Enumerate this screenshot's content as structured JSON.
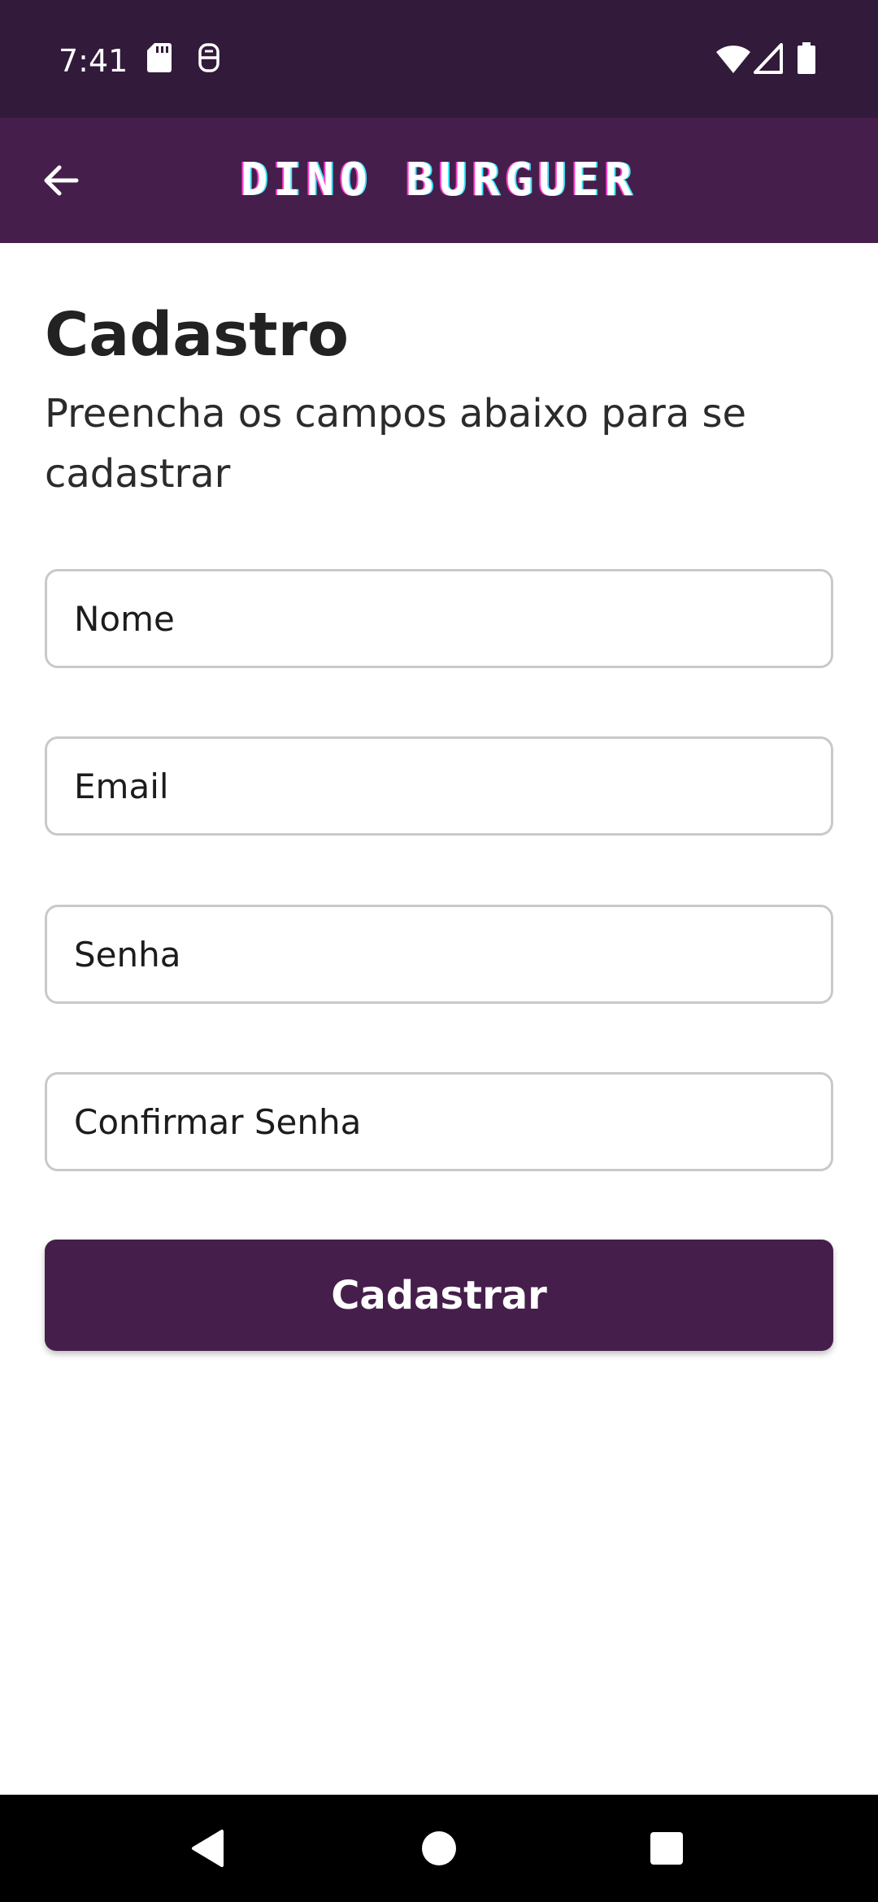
{
  "status_bar": {
    "time": "7:41",
    "left_icons": [
      "sd-card-icon",
      "notification-icon"
    ],
    "right_icons": [
      "wifi-icon",
      "signal-icon",
      "battery-icon"
    ]
  },
  "app_bar": {
    "back_icon": "arrow-left-icon",
    "title": "DINO BURGUER"
  },
  "page": {
    "title": "Cadastro",
    "subtitle": "Preencha os campos abaixo para se cadastrar"
  },
  "form": {
    "name_placeholder": "Nome",
    "name_value": "",
    "email_placeholder": "Email",
    "email_value": "",
    "password_placeholder": "Senha",
    "password_value": "",
    "confirm_password_placeholder": "Confirmar Senha",
    "confirm_password_value": "",
    "submit_label": "Cadastrar"
  },
  "nav_bar": {
    "icons": [
      "nav-back-icon",
      "nav-home-icon",
      "nav-recents-icon"
    ]
  },
  "colors": {
    "status_bar_bg": "#321a3a",
    "app_bar_bg": "#461e4b",
    "button_bg": "#461e4b",
    "field_border": "#c9c9c9"
  }
}
